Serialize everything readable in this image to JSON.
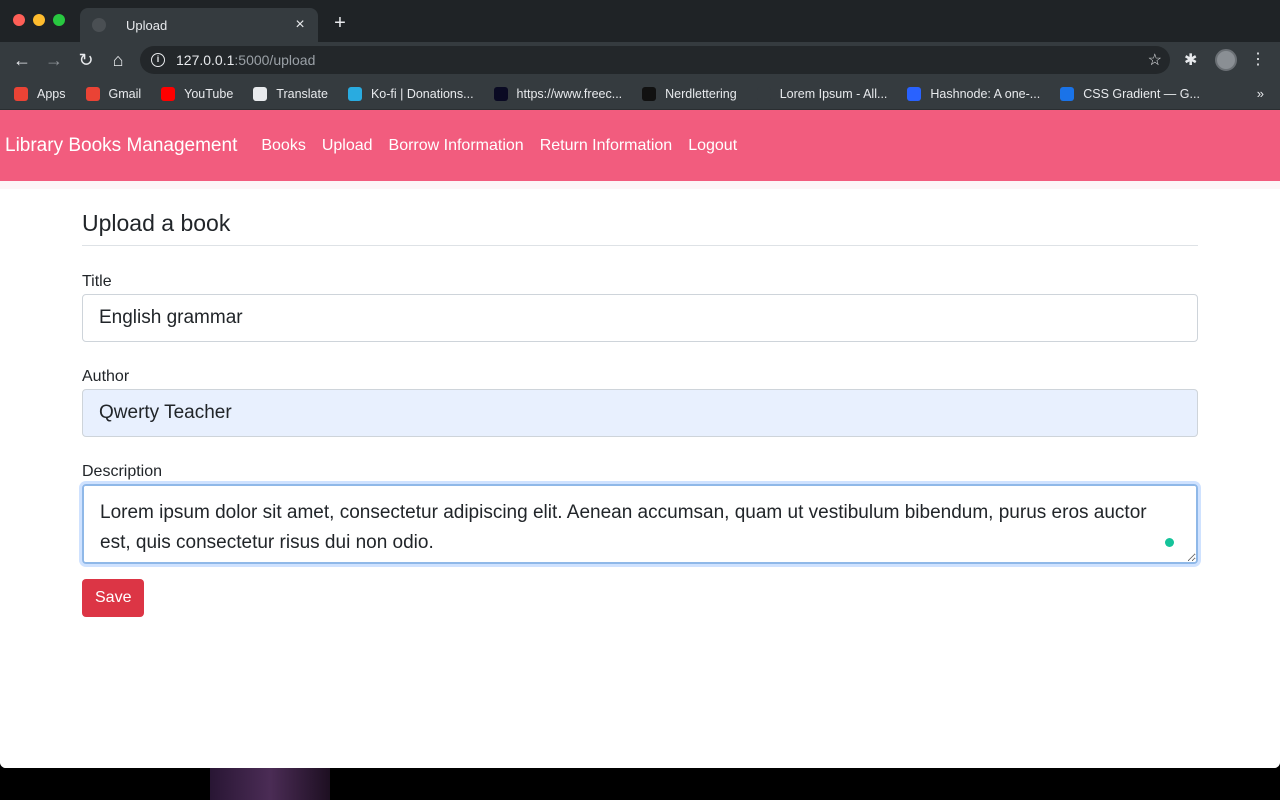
{
  "browser": {
    "tab_title": "Upload",
    "tab_close": "×",
    "new_tab": "+",
    "url_host": "127.0.0.1",
    "url_rest": ":5000/upload",
    "info_glyph": "i",
    "icons": {
      "back": "back-arrow-icon",
      "forward": "forward-arrow-icon",
      "reload": "reload-icon",
      "home": "home-icon",
      "star": "star-icon",
      "extensions": "puzzle-icon",
      "menu": "kebab-menu-icon"
    },
    "bookmarks": [
      {
        "label": "Apps",
        "color": "#ea4335"
      },
      {
        "label": "Gmail",
        "color": "#ea4335"
      },
      {
        "label": "YouTube",
        "color": "#ff0000"
      },
      {
        "label": "Translate",
        "color": "#e8eaed"
      },
      {
        "label": "Ko-fi | Donations...",
        "color": "#29abe0"
      },
      {
        "label": "https://www.freec...",
        "color": "#0a0a23"
      },
      {
        "label": "Nerdlettering",
        "color": "#111111"
      },
      {
        "label": "Lorem Ipsum - All...",
        "color": "#353b3f"
      },
      {
        "label": "Hashnode: A one-...",
        "color": "#2962ff"
      },
      {
        "label": "CSS Gradient — G...",
        "color": "#1a73e8"
      }
    ],
    "bookmarks_more": "»"
  },
  "navbar": {
    "brand": "Library Books Management",
    "links": [
      "Books",
      "Upload",
      "Borrow Information",
      "Return Information",
      "Logout"
    ],
    "color": "#f25c7e"
  },
  "form": {
    "heading": "Upload a book",
    "title_label": "Title",
    "title_value": "English grammar",
    "author_label": "Author",
    "author_value": "Qwerty Teacher",
    "description_label": "Description",
    "description_value": "Lorem ipsum dolor sit amet, consectetur adipiscing elit. Aenean accumsan, quam ut vestibulum bibendum, purus eros auctor est, quis consectetur risus dui non odio.",
    "save_label": "Save",
    "save_color": "#dc3545"
  }
}
